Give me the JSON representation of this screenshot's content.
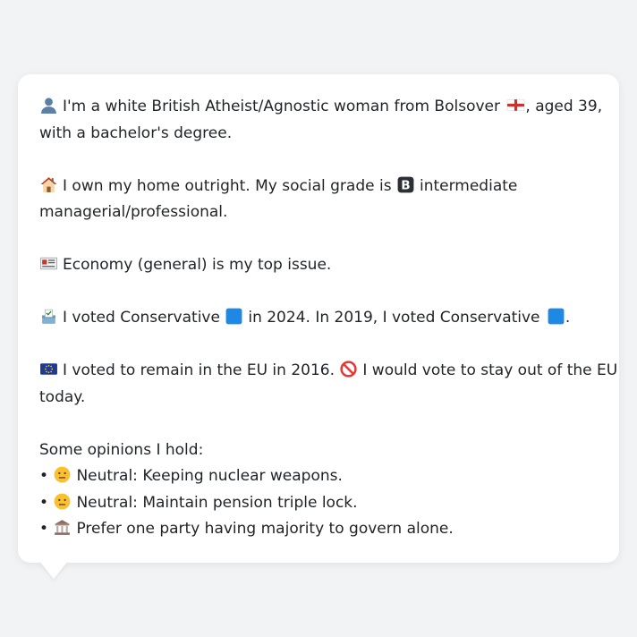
{
  "bio": {
    "identity_text": "I'm a white British Atheist/Agnostic woman from Bolsover",
    "identity_tail": ", aged 39,",
    "identity_line2": "with a bachelor's degree.",
    "home_text": "I own my home outright. My social grade is",
    "grade_letter": "B",
    "home_tail": "intermediate",
    "home_line2": "managerial/professional.",
    "issue_text": "Economy (general) is my top issue.",
    "vote_part1": "I voted Conservative",
    "vote_part2": "in 2024. In 2019, I voted Conservative",
    "vote_part3": ".",
    "eu_part1": "I voted to remain in the EU in 2016.",
    "eu_part2": "I would vote to stay out of the EU",
    "eu_line2": "today."
  },
  "opinions": {
    "heading": "Some opinions I hold:",
    "items": [
      {
        "bullet": "•",
        "icon": "neutral-face-icon",
        "text": "Neutral: Keeping nuclear weapons."
      },
      {
        "bullet": "•",
        "icon": "neutral-face-icon",
        "text": "Neutral: Maintain pension triple lock."
      },
      {
        "bullet": "•",
        "icon": "classical-building-icon",
        "text": "Prefer one party having majority to govern alone."
      }
    ]
  },
  "icons": {
    "person": "bust-in-silhouette-icon",
    "england": "england-flag-icon",
    "home": "house-icon",
    "grade": "b-button-icon",
    "issue": "newspaper-icon",
    "ballot": "ballot-box-icon",
    "party_color_1": "blue-square-icon",
    "party_color_2": "blue-square-icon",
    "eu": "eu-flag-icon",
    "prohibited": "prohibited-icon"
  },
  "colors": {
    "background": "#f2f3f5",
    "bubble": "#ffffff",
    "text": "#1f2328",
    "conservative_blue": "#1e88e5",
    "eu_blue": "#1f3a93",
    "prohibited_red": "#e53935"
  }
}
